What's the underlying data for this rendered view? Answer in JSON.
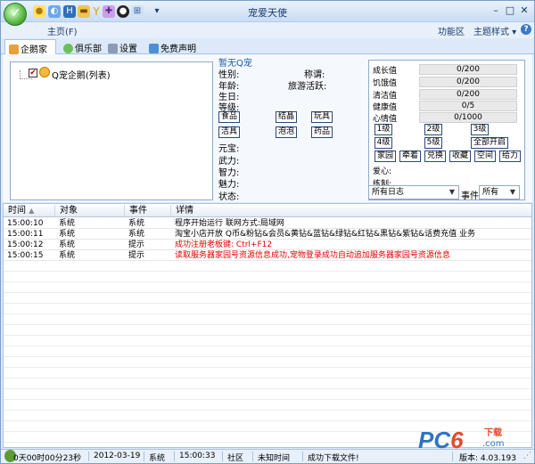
{
  "window": {
    "title": "宠爱天使"
  },
  "menu": {
    "home": "主页(F)",
    "func": "功能区",
    "theme": "主题样式"
  },
  "tabs": [
    {
      "label": "企鹅家园"
    },
    {
      "label": "俱乐部"
    },
    {
      "label": "设置"
    },
    {
      "label": "免费声明"
    }
  ],
  "tree": {
    "item": "Q宠企鹅(列表)"
  },
  "pet": {
    "title": "暂无Q宠",
    "labels": {
      "gender": "性别:",
      "title2": "称谓:",
      "age": "年龄:",
      "activity": "旅游活跃:",
      "birthday": "生日:",
      "level": "等级:",
      "gold": "元宝:",
      "force": "武力:",
      "intel": "智力:",
      "charm": "魅力:",
      "state": "状态:"
    },
    "buttons": {
      "food": "食品",
      "crystal": "结晶",
      "toy": "玩具",
      "clean": "洁具",
      "bubble": "泡泡",
      "medicine": "药品"
    }
  },
  "stats": {
    "rows": [
      {
        "label": "成长值",
        "value": "0/200"
      },
      {
        "label": "饥饿值",
        "value": "0/200"
      },
      {
        "label": "清洁值",
        "value": "0/200"
      },
      {
        "label": "健康值",
        "value": "0/5"
      },
      {
        "label": "心情值",
        "value": "0/1000"
      }
    ],
    "levels": [
      "1级",
      "2级",
      "3级",
      "4级",
      "5级",
      "全部开启"
    ],
    "actions": [
      "家园",
      "牵着",
      "兑换",
      "收藏",
      "空间",
      "给力"
    ],
    "love": "爱心:",
    "practice": "练制:"
  },
  "filters": {
    "log_filter": "所有日志",
    "event_label": "事件",
    "event_filter": "所有"
  },
  "log": {
    "headers": {
      "time": "时间",
      "object": "对象",
      "event": "事件",
      "detail": "详情"
    },
    "rows": [
      {
        "time": "15:00:10",
        "object": "系统",
        "event": "系统",
        "detail": "程序开始运行 联网方式:局域网",
        "red": false
      },
      {
        "time": "15:00:11",
        "object": "系统",
        "event": "系统",
        "detail": "淘宝小店开放 Q币&粉钻&会员&黄钻&蓝钻&绿钻&红钻&黑钻&紫钻&话费充值 业务",
        "red": false
      },
      {
        "time": "15:00:12",
        "object": "系统",
        "event": "提示",
        "detail": "成功注册老板键: Ctrl+F12",
        "red": true
      },
      {
        "time": "15:00:15",
        "object": "系统",
        "event": "提示",
        "detail": "读取服务器家园号资源信息成功,宠物登录成功自动追加服务器家园号资源信息",
        "red": true
      }
    ]
  },
  "watermark": {
    "pc": "PC",
    "six": "6",
    "sub": "下载",
    "com": ".com"
  },
  "status": {
    "uptime": "0天00时00分23秒",
    "date": "2012-03-19",
    "sys": "系统",
    "clock": "15:00:33",
    "community": "社区",
    "unknown": "未知时间",
    "download": "成功下载文件!",
    "version": "版本: 4.03.193"
  }
}
